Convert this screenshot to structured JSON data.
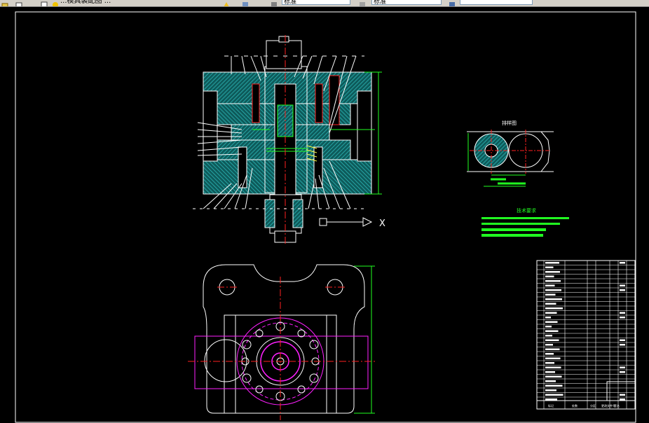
{
  "toolbar": {
    "file_name_label": "...模具装配图 ...",
    "style_combo_1": "标准",
    "style_combo_2": "标准",
    "icons": [
      "open-icon",
      "folder-icon",
      "layer-icon",
      "properties-icon",
      "text-style-icon",
      "dim-style-icon",
      "table-style-icon"
    ]
  },
  "drawing": {
    "background": "#000000",
    "colors": {
      "outline": "#ffffff",
      "hatch": "#26b3b3",
      "center": "#ff2020",
      "dimension": "#21ff21",
      "magenta": "#ff20ff",
      "blue": "#4040ff",
      "yellow": "#ffff40"
    },
    "x_marker": "X",
    "detail_title": "排样图",
    "tech_req_title": "技术要求",
    "title_block_bottom": [
      "标记",
      "处数",
      "分区",
      "更改文件号",
      "签名"
    ]
  }
}
